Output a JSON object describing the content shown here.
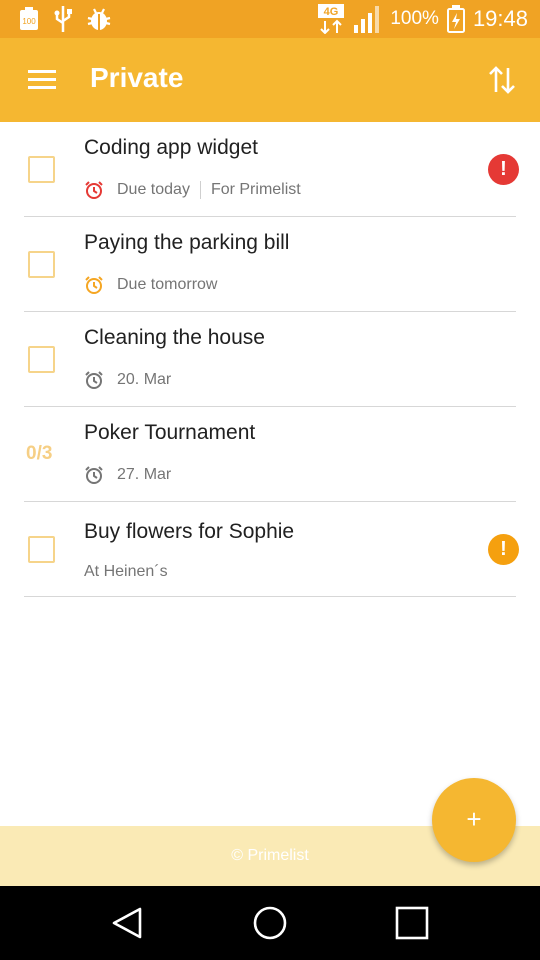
{
  "status_bar": {
    "battery_icon_label": "100",
    "network": "4G",
    "battery_percent": "100%",
    "time": "19:48"
  },
  "app_bar": {
    "title": "Private"
  },
  "tasks": [
    {
      "title": "Coding app widget",
      "due": "Due today",
      "extra": "For Primelist",
      "priority": "!",
      "priority_color": "#e53935",
      "alarm_color": "#e53935"
    },
    {
      "title": "Paying the parking bill",
      "due": "Due tomorrow",
      "alarm_color": "#f5a623"
    },
    {
      "title": "Cleaning the house",
      "due": "20. Mar",
      "alarm_color": "#757575"
    },
    {
      "title": "Poker Tournament",
      "due": "27. Mar",
      "counter": "0/3",
      "alarm_color": "#757575"
    },
    {
      "title": "Buy flowers for Sophie",
      "note": "At Heinen´s",
      "priority": "!",
      "priority_color": "#f5a00f"
    }
  ],
  "footer": {
    "text": "© Primelist"
  },
  "fab": {
    "label": "+"
  },
  "colors": {
    "status_bar": "#f0a324",
    "app_bar": "#f5b731",
    "footer": "#faeab5",
    "checkbox_border": "#f6d48a"
  }
}
